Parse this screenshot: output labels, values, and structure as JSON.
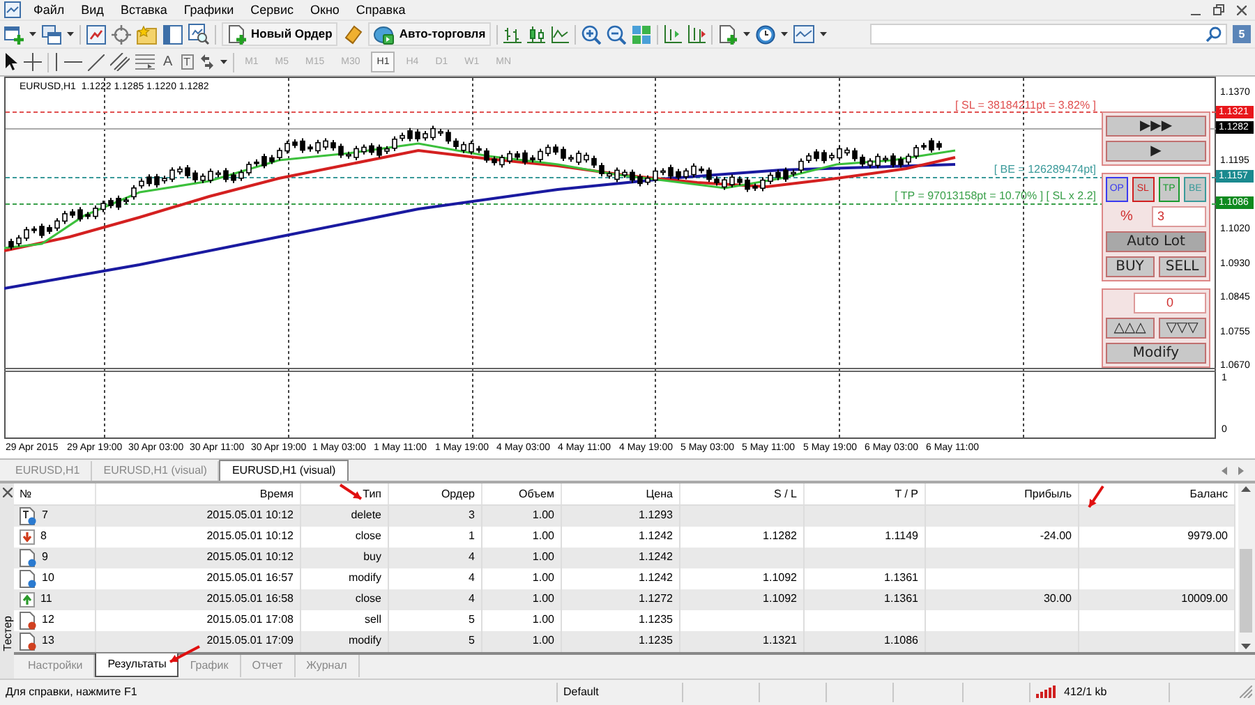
{
  "menu_bar": {
    "items": [
      "Файл",
      "Вид",
      "Вставка",
      "Графики",
      "Сервис",
      "Окно",
      "Справка"
    ]
  },
  "toolbar": {
    "buttons": [
      {
        "label": "Новый Ордер"
      },
      {
        "label": "Авто-торговля"
      }
    ],
    "notifications_badge": "5"
  },
  "drawing_toolbar": {
    "text_tools": [
      "A",
      "T"
    ],
    "timeframes": [
      {
        "label": "M1",
        "selected": false,
        "disabled": true
      },
      {
        "label": "M5",
        "selected": false,
        "disabled": true
      },
      {
        "label": "M15",
        "selected": false,
        "disabled": true
      },
      {
        "label": "M30",
        "selected": false,
        "disabled": true
      },
      {
        "label": "H1",
        "selected": true,
        "disabled": false
      },
      {
        "label": "H4",
        "selected": false,
        "disabled": true
      },
      {
        "label": "D1",
        "selected": false,
        "disabled": true
      },
      {
        "label": "W1",
        "selected": false,
        "disabled": true
      },
      {
        "label": "MN",
        "selected": false,
        "disabled": true
      }
    ]
  },
  "chart": {
    "header": "EURUSD,H1  1.1222 1.1285 1.1220 1.1282",
    "trade_labels": [
      {
        "kind": "sl",
        "text": "[ SL = 38184211pt = 3.82% ]"
      },
      {
        "kind": "be",
        "text": "[ BE = 126289474pt]"
      },
      {
        "kind": "tp",
        "text": "[ TP = 97013158pt = 10.70% ] [ SL x 2.2]"
      }
    ],
    "price_axis": {
      "ticks": [
        "1.1370",
        "1.1195",
        "1.1020",
        "1.0930",
        "1.0845",
        "1.0755",
        "1.0670"
      ],
      "markers": [
        {
          "label": "1.1321",
          "color": "#e8161b"
        },
        {
          "label": "1.1282",
          "color": "#000000"
        },
        {
          "label": "1.1157",
          "color": "#1a8a8f"
        },
        {
          "label": "1.1086",
          "color": "#0f8a1f"
        }
      ]
    },
    "sub_axis": {
      "ticks": [
        "1",
        "0"
      ]
    },
    "time_axis": [
      "29 Apr 2015",
      "29 Apr 19:00",
      "30 Apr 03:00",
      "30 Apr 11:00",
      "30 Apr 19:00",
      "1 May 03:00",
      "1 May 11:00",
      "1 May 19:00",
      "4 May 03:00",
      "4 May 11:00",
      "4 May 19:00",
      "5 May 03:00",
      "5 May 11:00",
      "5 May 19:00",
      "6 May 03:00",
      "6 May 11:00"
    ],
    "trade_panel": {
      "fast_buttons": [
        "▶▶▶",
        "▶"
      ],
      "line_buttons": [
        {
          "label": "OP",
          "color": "#3a3af0"
        },
        {
          "label": "SL",
          "color": "#d02020"
        },
        {
          "label": "TP",
          "color": "#1a9a30"
        },
        {
          "label": "BE",
          "color": "#3a9a9a"
        }
      ],
      "risk_label": "%",
      "risk_value": "3",
      "auto_lot": "Auto Lot",
      "buy": "BUY",
      "sell": "SELL",
      "points_value": "0",
      "up": "△△△",
      "down": "▽▽▽",
      "modify": "Modify"
    }
  },
  "chart_tabs": [
    {
      "label": "EURUSD,H1",
      "selected": false
    },
    {
      "label": "EURUSD,H1 (visual)",
      "selected": false
    },
    {
      "label": "EURUSD,H1 (visual)",
      "selected": true
    }
  ],
  "tester": {
    "title": "Тестер",
    "columns": [
      "№",
      "Время",
      "Тип",
      "Ордер",
      "Объем",
      "Цена",
      "S / L",
      "T / P",
      "Прибыль",
      "Баланс"
    ],
    "rows": [
      {
        "kind": "pending",
        "no": "7",
        "time": "2015.05.01 10:12",
        "type": "delete",
        "order": "3",
        "volume": "1.00",
        "price": "1.1293"
      },
      {
        "kind": "close_loss",
        "no": "8",
        "time": "2015.05.01 10:12",
        "type": "close",
        "order": "1",
        "volume": "1.00",
        "price": "1.1242",
        "sl": "1.1282",
        "tp": "1.1149",
        "profit": "-24.00",
        "balance": "9979.00"
      },
      {
        "kind": "buy",
        "no": "9",
        "time": "2015.05.01 10:12",
        "type": "buy",
        "order": "4",
        "volume": "1.00",
        "price": "1.1242"
      },
      {
        "kind": "buy",
        "no": "10",
        "time": "2015.05.01 16:57",
        "type": "modify",
        "order": "4",
        "volume": "1.00",
        "price": "1.1242",
        "sl": "1.1092",
        "tp": "1.1361"
      },
      {
        "kind": "close_profit",
        "no": "11",
        "time": "2015.05.01 16:58",
        "type": "close",
        "order": "4",
        "volume": "1.00",
        "price": "1.1272",
        "sl": "1.1092",
        "tp": "1.1361",
        "profit": "30.00",
        "balance": "10009.00"
      },
      {
        "kind": "sell",
        "no": "12",
        "time": "2015.05.01 17:08",
        "type": "sell",
        "order": "5",
        "volume": "1.00",
        "price": "1.1235"
      },
      {
        "kind": "sell",
        "no": "13",
        "time": "2015.05.01 17:09",
        "type": "modify",
        "order": "5",
        "volume": "1.00",
        "price": "1.1235",
        "sl": "1.1321",
        "tp": "1.1086"
      }
    ],
    "tabs": [
      {
        "label": "Настройки",
        "selected": false
      },
      {
        "label": "Результаты",
        "selected": true
      },
      {
        "label": "График",
        "selected": false
      },
      {
        "label": "Отчет",
        "selected": false
      },
      {
        "label": "Журнал",
        "selected": false
      }
    ]
  },
  "status_bar": {
    "help": "Для справки, нажмите F1",
    "profile": "Default",
    "traffic": "412/1 kb"
  }
}
